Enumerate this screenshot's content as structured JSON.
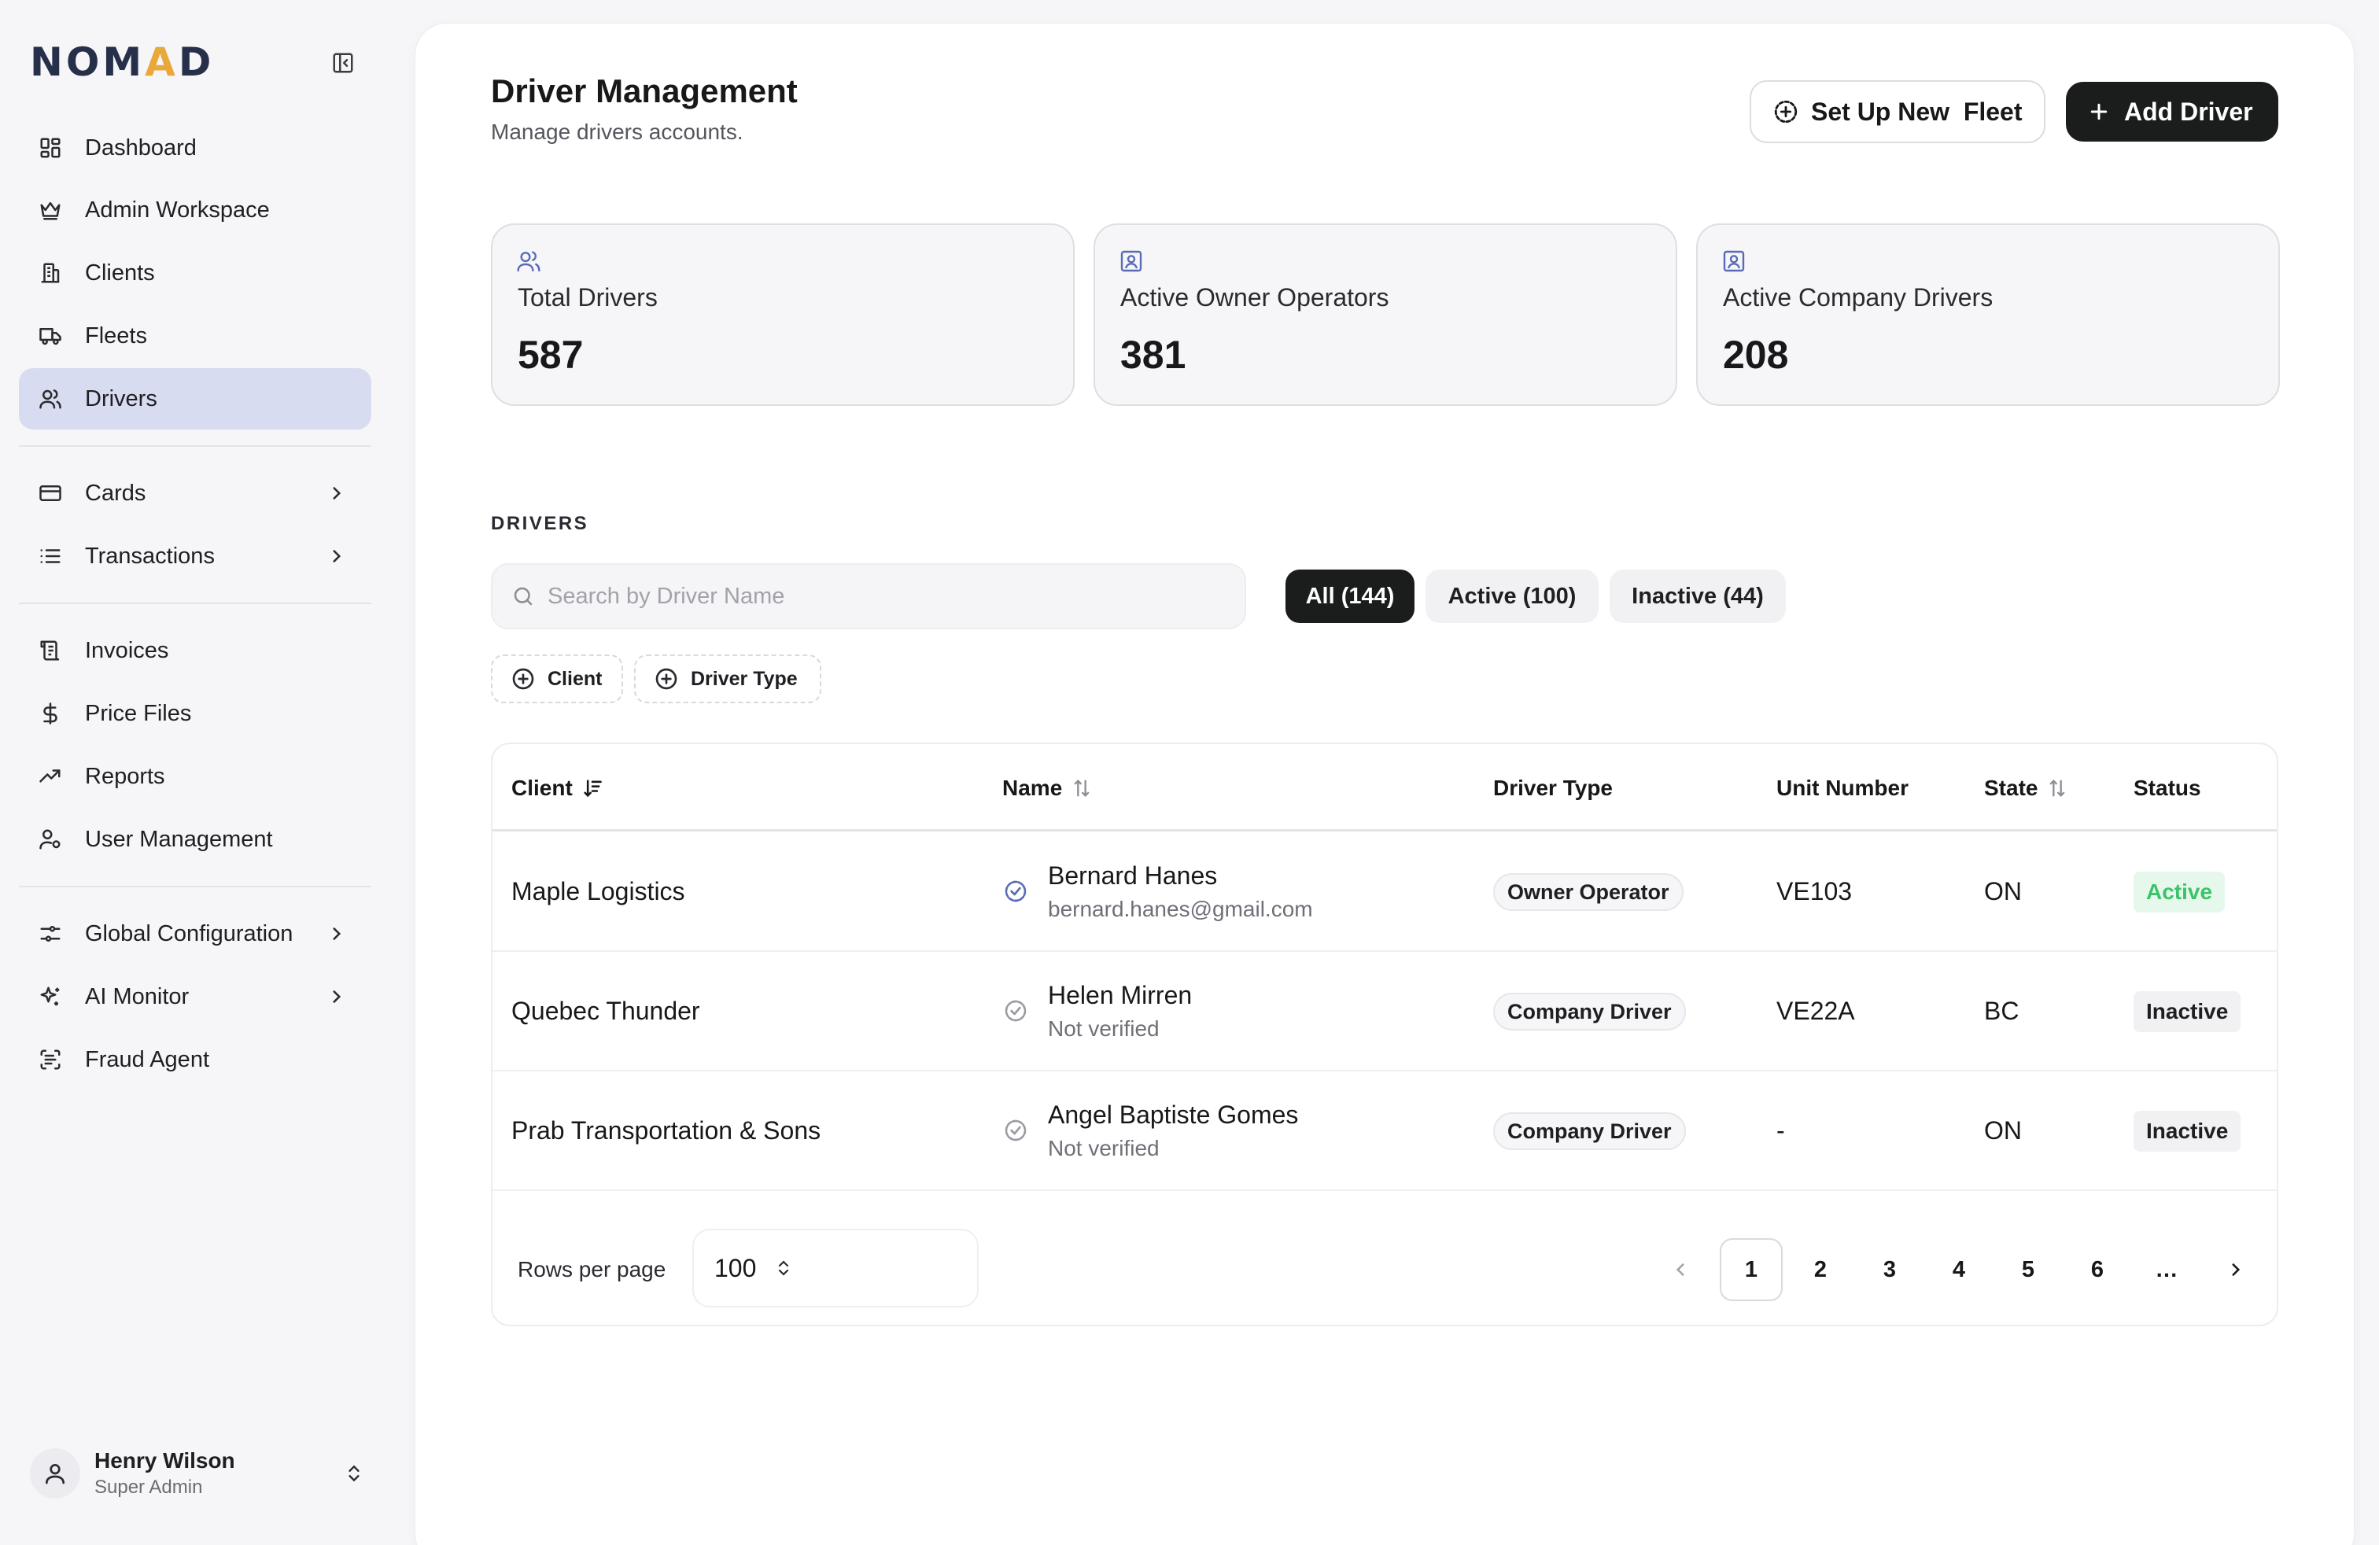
{
  "sidebar": {
    "logo_pre": "NOM",
    "logo_accent": "A",
    "logo_post": "D",
    "nav": [
      {
        "label": "Dashboard",
        "icon": "dashboard-icon"
      },
      {
        "label": "Admin Workspace",
        "icon": "crown-icon"
      },
      {
        "label": "Clients",
        "icon": "building-icon"
      },
      {
        "label": "Fleets",
        "icon": "truck-icon"
      },
      {
        "label": "Drivers",
        "icon": "users-icon",
        "active": true
      },
      {
        "label": "Cards",
        "icon": "credit-card-icon",
        "has_children": true
      },
      {
        "label": "Transactions",
        "icon": "list-icon",
        "has_children": true
      },
      {
        "label": "Invoices",
        "icon": "receipt-icon"
      },
      {
        "label": "Price Files",
        "icon": "dollar-icon"
      },
      {
        "label": "Reports",
        "icon": "trending-up-icon"
      },
      {
        "label": "User Management",
        "icon": "user-cog-icon"
      },
      {
        "label": "Global Configuration",
        "icon": "sliders-icon",
        "has_children": true
      },
      {
        "label": "AI Monitor",
        "icon": "sparkles-icon",
        "has_children": true
      },
      {
        "label": "Fraud Agent",
        "icon": "scan-text-icon"
      }
    ],
    "user": {
      "name": "Henry Wilson",
      "role": "Super Admin"
    }
  },
  "header": {
    "title": "Driver Management",
    "subtitle": "Manage drivers accounts.",
    "setup_fleet_label": "Set Up New  Fleet",
    "add_driver_label": "Add Driver"
  },
  "stats": [
    {
      "label": "Total Drivers",
      "value": "587",
      "icon": "users-icon"
    },
    {
      "label": "Active Owner Operators",
      "value": "381",
      "icon": "contact-icon"
    },
    {
      "label": "Active Company Drivers",
      "value": "208",
      "icon": "contact-icon"
    }
  ],
  "drivers": {
    "section_label": "DRIVERS",
    "search_placeholder": "Search by Driver Name",
    "search_value": "",
    "tabs": [
      {
        "label": "All (144)",
        "active": true
      },
      {
        "label": "Active (100)"
      },
      {
        "label": "Inactive (44)"
      }
    ],
    "filters": [
      "Client",
      "Driver Type"
    ],
    "columns": [
      "Client",
      "Name",
      "Driver Type",
      "Unit Number",
      "State",
      "Status"
    ],
    "rows": [
      {
        "client": "Maple Logistics",
        "name": "Bernard Hanes",
        "sub": "bernard.hanes@gmail.com",
        "verified": true,
        "type": "Owner Operator",
        "unit": "VE103",
        "state": "ON",
        "status": "Active"
      },
      {
        "client": "Quebec Thunder",
        "name": "Helen Mirren",
        "sub": "Not verified",
        "verified": false,
        "type": "Company Driver",
        "unit": "VE22A",
        "state": "BC",
        "status": "Inactive"
      },
      {
        "client": "Prab Transportation & Sons",
        "name": "Angel Baptiste Gomes",
        "sub": "Not verified",
        "verified": false,
        "type": "Company Driver",
        "unit": "-",
        "state": "ON",
        "status": "Inactive"
      }
    ],
    "rows_per_page_label": "Rows per page",
    "rows_per_page_value": "100",
    "pages": [
      "1",
      "2",
      "3",
      "4",
      "5",
      "6"
    ],
    "current_page": "1",
    "ellipsis": "…"
  },
  "colors": {
    "logo": "#27304a",
    "logo_accent": "#e9a83a",
    "active_nav_bg": "#d8dcf0",
    "primary_button": "#1b1d1d",
    "status_active": "#3cc36a",
    "verified_icon": "#5a6bb5"
  }
}
